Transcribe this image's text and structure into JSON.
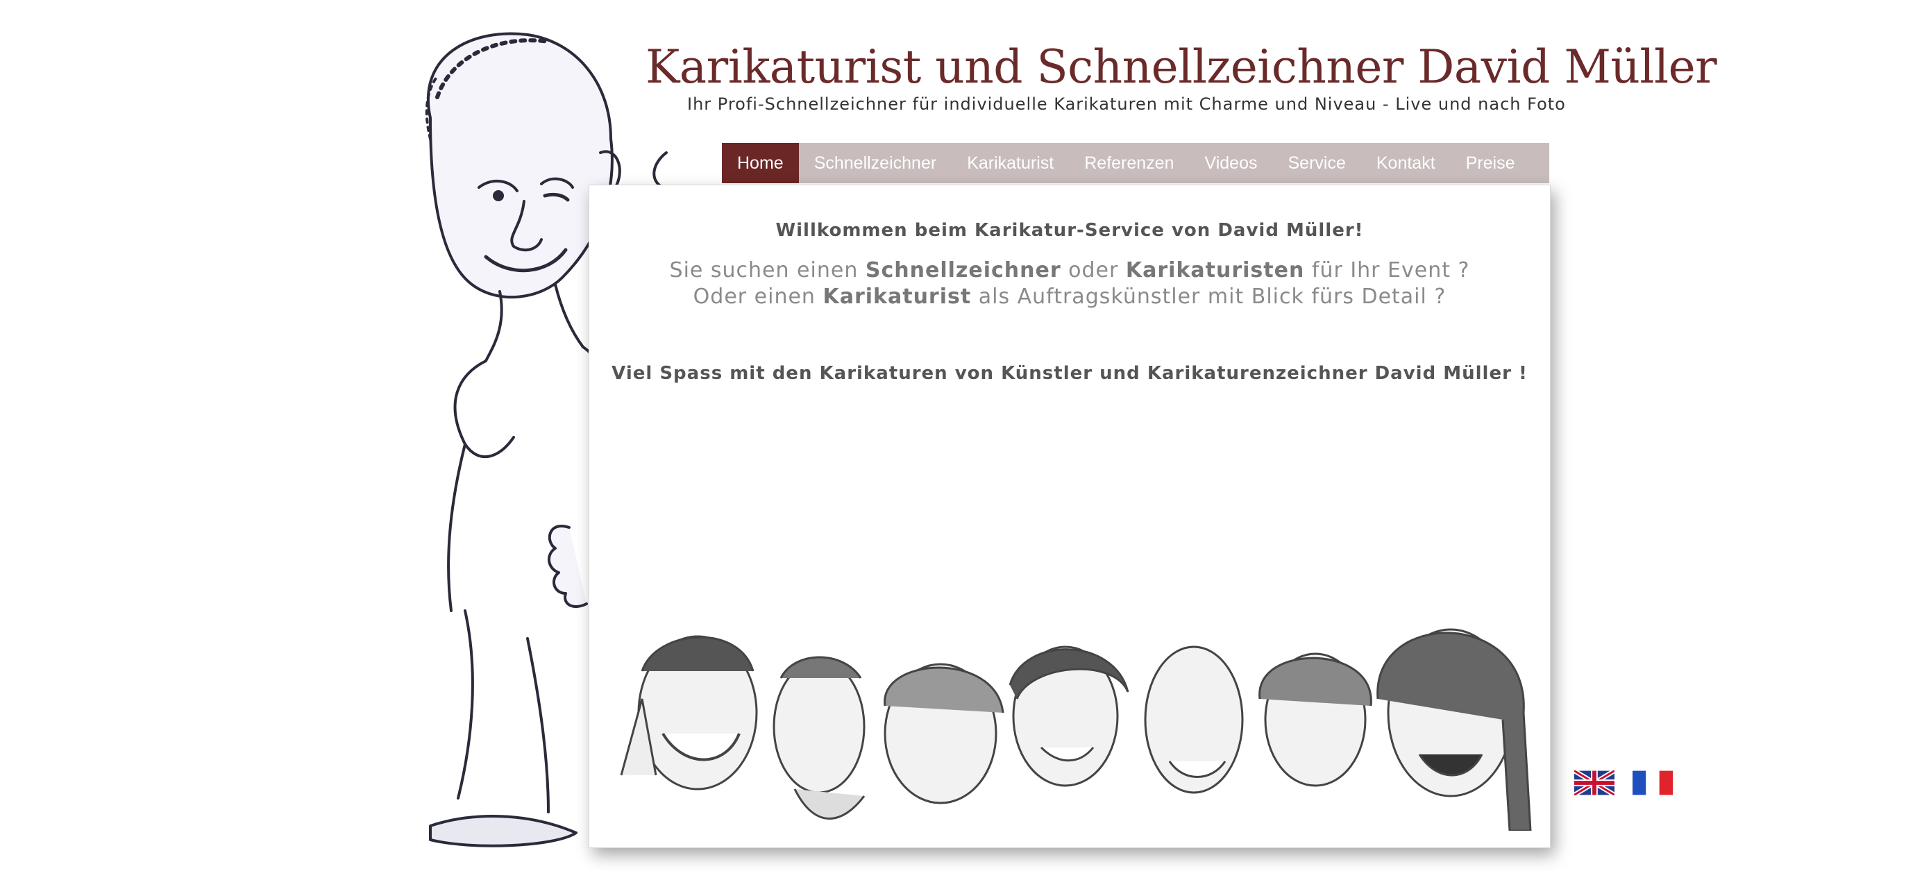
{
  "header": {
    "title": "Karikaturist und Schnellzeichner David Müller",
    "subtitle": "Ihr Profi-Schnellzeichner für individuelle Karikaturen mit Charme und Niveau - Live und nach Foto"
  },
  "nav": {
    "items": [
      {
        "label": "Home",
        "active": true
      },
      {
        "label": "Schnellzeichner",
        "active": false
      },
      {
        "label": "Karikaturist",
        "active": false
      },
      {
        "label": "Referenzen",
        "active": false
      },
      {
        "label": "Videos",
        "active": false
      },
      {
        "label": "Service",
        "active": false
      },
      {
        "label": "Kontakt",
        "active": false
      },
      {
        "label": "Preise",
        "active": false
      }
    ]
  },
  "content": {
    "welcome": "Willkommen beim Karikatur-Service von David Müller!",
    "line1": {
      "pre": "Sie suchen einen ",
      "b1": "Schnellzeichner",
      "mid": " oder ",
      "b2": "Karikaturisten",
      "post": " für Ihr Event ?"
    },
    "line2": {
      "pre": "Oder einen ",
      "b1": "Karikaturist",
      "post": " als Auftragskünstler mit Blick fürs Detail ?"
    },
    "closing": "Viel Spass mit den Karikaturen von Künstler und Karikaturenzeichner David Müller !"
  },
  "flags": [
    {
      "name": "english-flag-icon"
    },
    {
      "name": "french-flag-icon"
    }
  ],
  "colors": {
    "title": "#6b2a2a",
    "nav_bg": "#c8bcbc",
    "nav_active": "#6b2626",
    "nav_text": "#ffffff"
  }
}
